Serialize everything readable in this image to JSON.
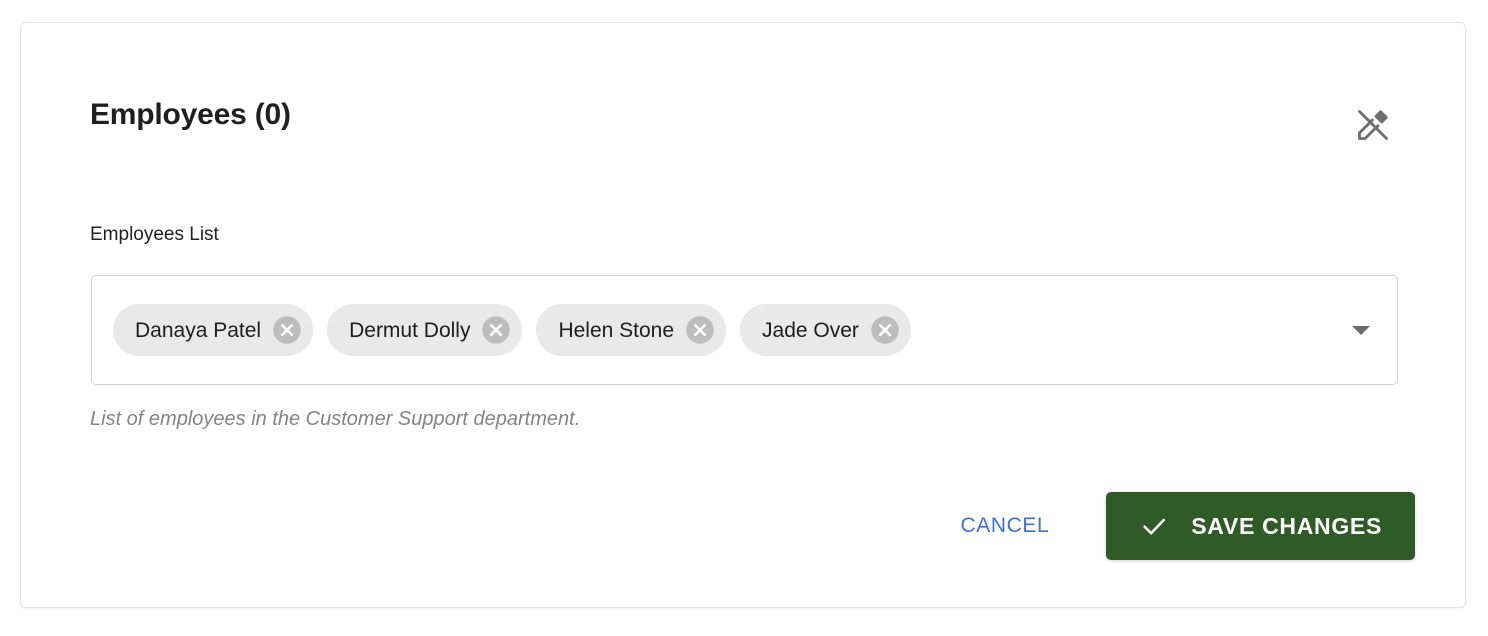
{
  "card": {
    "title": "Employees (0)",
    "edit_toggle_icon": "edit-off-icon"
  },
  "field": {
    "label": "Employees List",
    "helper_text": "List of employees in the Customer Support department.",
    "dropdown_icon": "chevron-down-icon",
    "chips": [
      {
        "label": "Danaya Patel",
        "remove_icon": "close-circle-icon"
      },
      {
        "label": "Dermut Dolly",
        "remove_icon": "close-circle-icon"
      },
      {
        "label": "Helen Stone",
        "remove_icon": "close-circle-icon"
      },
      {
        "label": "Jade Over",
        "remove_icon": "close-circle-icon"
      }
    ]
  },
  "actions": {
    "cancel_label": "CANCEL",
    "save_label": "SAVE CHANGES",
    "save_icon": "check-icon"
  },
  "colors": {
    "save_button_bg": "#2f5b26",
    "cancel_text": "#3b73cf",
    "chip_bg": "#e9e9e9",
    "chip_remove": "#bdbdbd",
    "helper_text": "#848484",
    "card_border": "#e2e2e2",
    "input_border": "#d0d0d0"
  }
}
